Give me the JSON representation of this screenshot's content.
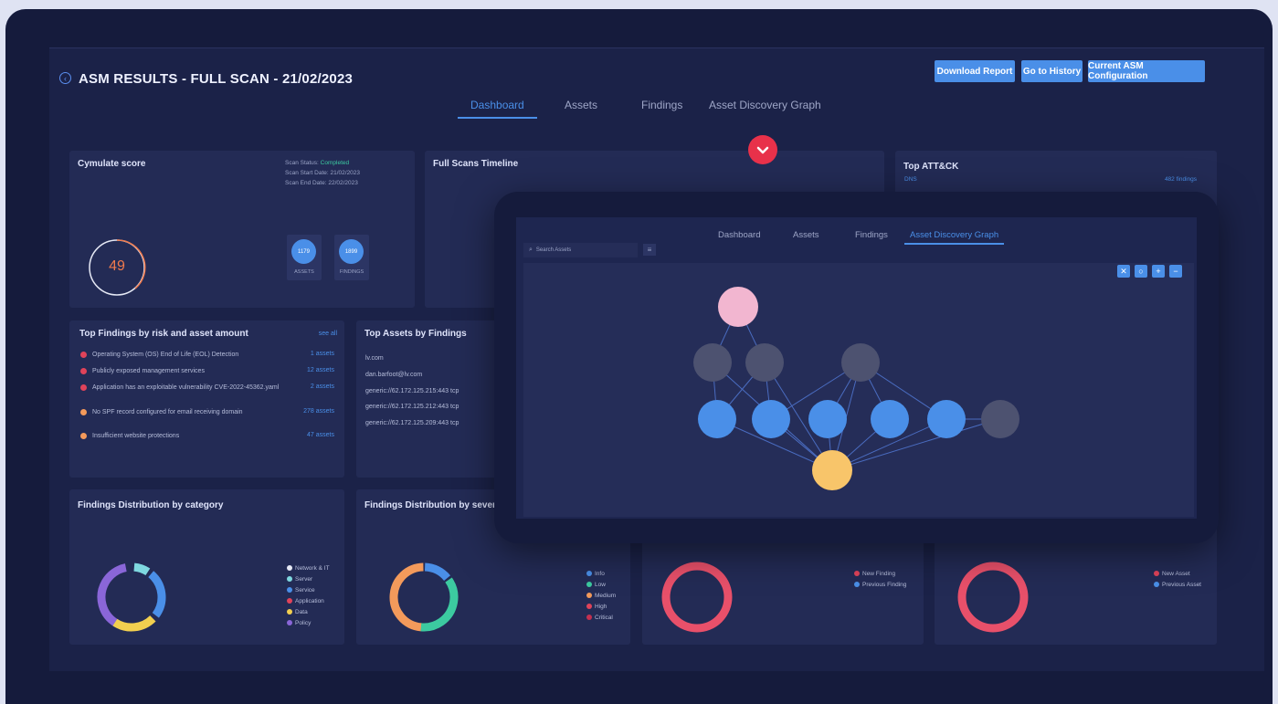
{
  "header": {
    "title": "ASM RESULTS - FULL SCAN - 21/02/2023",
    "buttons": [
      "Download Report",
      "Go to History",
      "Current ASM Configuration"
    ]
  },
  "tabs": [
    "Dashboard",
    "Assets",
    "Findings",
    "Asset Discovery Graph"
  ],
  "score_card": {
    "title": "Cymulate score",
    "scan_status_label": "Scan Status:",
    "scan_status": "Completed",
    "start_date": "Scan Start Date: 21/02/2023",
    "end_date": "Scan End Date: 22/02/2023",
    "score": "49",
    "assets_count": "1179",
    "assets_label": "ASSETS",
    "findings_count": "1899",
    "findings_label": "FINDINGS"
  },
  "timeline": {
    "title": "Full Scans Timeline"
  },
  "attack": {
    "title": "Top ATT&CK",
    "item": "DNS",
    "value": "482 findings"
  },
  "top_findings": {
    "title": "Top Findings by risk and asset amount",
    "see_all": "see all",
    "rows": [
      {
        "text": "Operating System (OS) End of Life (EOL) Detection",
        "assets": "1 assets",
        "color": "#e0435a"
      },
      {
        "text": "Publicly exposed management services",
        "assets": "12 assets",
        "color": "#e0435a"
      },
      {
        "text": "Application has an exploitable vulnerability CVE-2022-45362.yaml",
        "assets": "2 assets",
        "color": "#e0435a"
      },
      {
        "text": "No SPF record configured for email receiving domain",
        "assets": "278 assets",
        "color": "#f39a5b"
      },
      {
        "text": "Insufficient website protections",
        "assets": "47 assets",
        "color": "#f39a5b"
      }
    ]
  },
  "top_assets": {
    "title": "Top Assets by Findings",
    "items": [
      "lv.com",
      "dan.barfoot@lv.com",
      "generic://62.172.125.215:443 tcp",
      "generic://62.172.125.212:443 tcp",
      "generic://62.172.125.209:443 tcp"
    ]
  },
  "dist_category": {
    "title": "Findings Distribution by category",
    "legend": [
      {
        "label": "Network & IT",
        "color": "#e6e9f5"
      },
      {
        "label": "Server",
        "color": "#7fd8e0"
      },
      {
        "label": "Service",
        "color": "#4a8fe8"
      },
      {
        "label": "Application",
        "color": "#e0435a"
      },
      {
        "label": "Data",
        "color": "#f2cf4f"
      },
      {
        "label": "Policy",
        "color": "#8a66d8"
      }
    ]
  },
  "dist_severity": {
    "title": "Findings Distribution by severity",
    "legend": [
      {
        "label": "Info",
        "color": "#4a8fe8"
      },
      {
        "label": "Low",
        "color": "#3ccaa0"
      },
      {
        "label": "Medium",
        "color": "#f39a5b"
      },
      {
        "label": "High",
        "color": "#e0435a"
      },
      {
        "label": "Critical",
        "color": "#c43050"
      }
    ]
  },
  "new_findings": {
    "legend": [
      {
        "label": "New Finding",
        "color": "#e0435a"
      },
      {
        "label": "Previous Finding",
        "color": "#4a8fe8"
      }
    ]
  },
  "new_assets": {
    "legend": [
      {
        "label": "New Asset",
        "color": "#e0435a"
      },
      {
        "label": "Previous Asset",
        "color": "#4a8fe8"
      }
    ]
  },
  "overlay": {
    "tabs": [
      "Dashboard",
      "Assets",
      "Findings",
      "Asset Discovery Graph"
    ],
    "search_placeholder": "Search Assets"
  },
  "colors": {
    "accent": "#4a8fe8",
    "danger": "#e8314a",
    "bg": "#1b2248",
    "card": "#232b55"
  }
}
